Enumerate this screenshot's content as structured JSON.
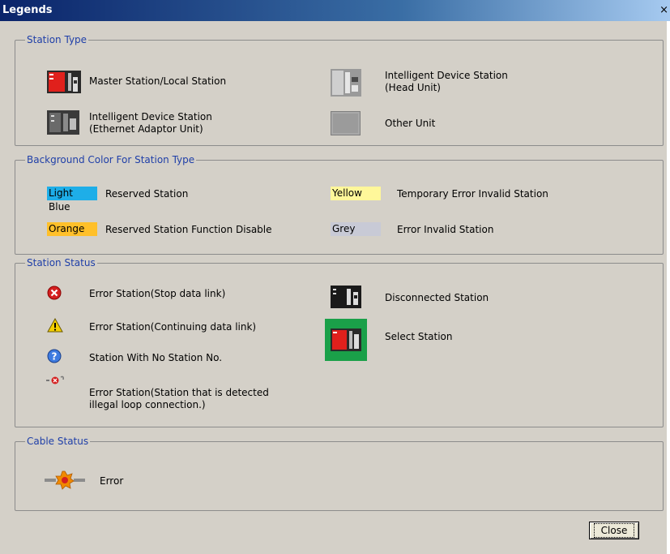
{
  "window": {
    "title": "Legends",
    "close_glyph": "×"
  },
  "station_type": {
    "legend": "Station Type",
    "items": [
      {
        "icon": "master-station-icon",
        "label": "Master Station/Local Station"
      },
      {
        "icon": "intelligent-head-unit-icon",
        "label_line1": "Intelligent Device Station",
        "label_line2": "(Head Unit)"
      },
      {
        "icon": "intelligent-ethernet-adaptor-icon",
        "label_line1": "Intelligent Device Station",
        "label_line2": "(Ethernet Adaptor Unit)"
      },
      {
        "icon": "other-unit-icon",
        "label": "Other Unit"
      }
    ]
  },
  "background_color": {
    "legend": "Background Color For Station Type",
    "items": [
      {
        "swatch": "Light Blue",
        "color": "#1eaee8",
        "label": "Reserved Station"
      },
      {
        "swatch": "Yellow",
        "color": "#fff79a",
        "label": "Temporary Error Invalid Station"
      },
      {
        "swatch": "Orange",
        "color": "#ffc02a",
        "label": "Reserved Station Function Disable"
      },
      {
        "swatch": "Grey",
        "color": "#c8cad6",
        "label": "Error Invalid Station"
      }
    ]
  },
  "station_status": {
    "legend": "Station Status",
    "items": [
      {
        "icon": "error-stop-icon",
        "label": "Error Station(Stop data link)"
      },
      {
        "icon": "warning-icon",
        "label": "Error Station(Continuing data link)"
      },
      {
        "icon": "question-icon",
        "label": "Station With No Station No."
      },
      {
        "icon": "illegal-loop-icon",
        "label_line1": "Error Station(Station that is detected",
        "label_line2": "illegal loop connection.)"
      },
      {
        "icon": "disconnected-station-icon",
        "label": "Disconnected Station"
      },
      {
        "icon": "select-station-icon",
        "label": "Select Station"
      }
    ]
  },
  "cable_status": {
    "legend": "Cable Status",
    "items": [
      {
        "icon": "cable-error-icon",
        "label": "Error"
      }
    ]
  },
  "footer": {
    "close_label": "Close"
  }
}
